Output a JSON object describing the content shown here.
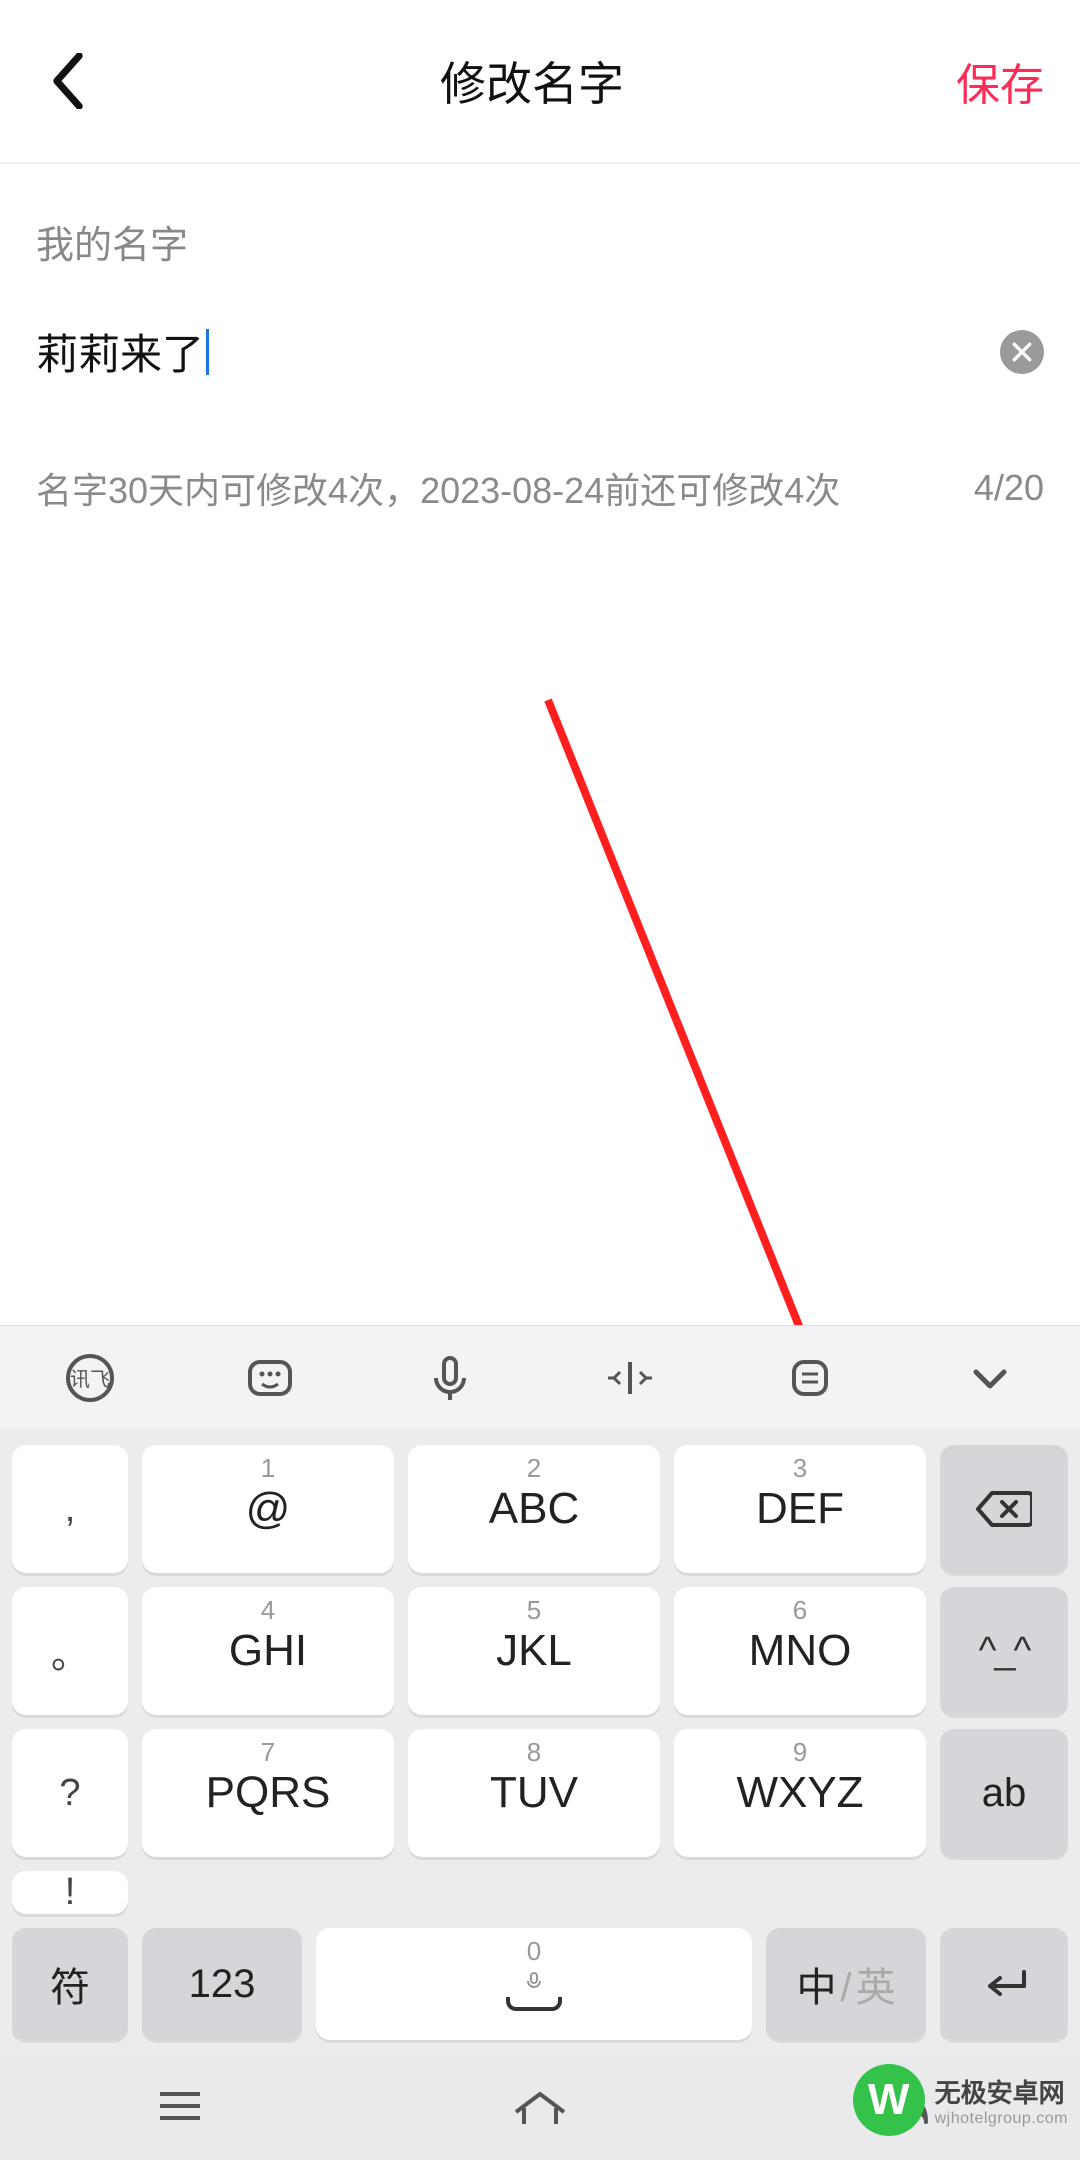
{
  "header": {
    "title": "修改名字",
    "save_label": "保存"
  },
  "field": {
    "label": "我的名字",
    "value": "莉莉来了",
    "hint": "名字30天内可修改4次，2023-08-24前还可修改4次",
    "counter": "4/20"
  },
  "keyboard": {
    "side_left": [
      ",",
      "。",
      "?",
      "!"
    ],
    "main": [
      {
        "sup": "1",
        "label": "@"
      },
      {
        "sup": "2",
        "label": "ABC"
      },
      {
        "sup": "3",
        "label": "DEF"
      },
      {
        "sup": "4",
        "label": "GHI"
      },
      {
        "sup": "5",
        "label": "JKL"
      },
      {
        "sup": "6",
        "label": "MNO"
      },
      {
        "sup": "7",
        "label": "PQRS"
      },
      {
        "sup": "8",
        "label": "TUV"
      },
      {
        "sup": "9",
        "label": "WXYZ"
      }
    ],
    "side_right": {
      "emoji": "^_^",
      "ab": "ab"
    },
    "bottom": {
      "symbol": "符",
      "num": "123",
      "space_sup": "0",
      "lang_zh": "中",
      "lang_en": "英"
    }
  },
  "watermark": {
    "line1": "无极安卓网",
    "line2": "wjhotelgroup.com"
  },
  "icons": {
    "back": "back-chevron",
    "clear": "clear-x",
    "toolbar": [
      "ime-logo",
      "keyboard",
      "mic",
      "cursor-move",
      "clipboard",
      "collapse"
    ]
  },
  "colors": {
    "accent": "#ff2a55",
    "arrow": "#ff1f1f"
  }
}
